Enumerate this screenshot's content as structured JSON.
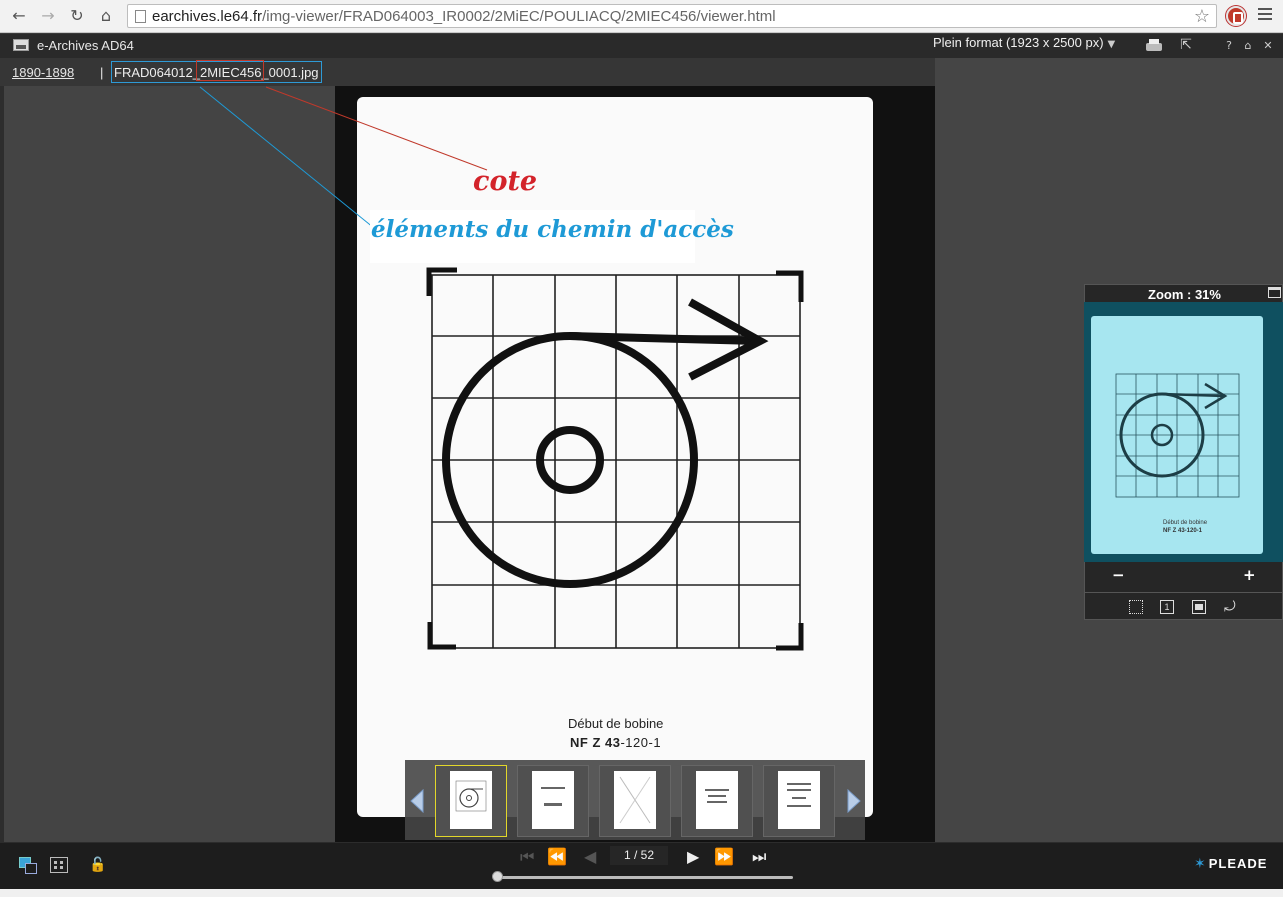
{
  "browser": {
    "url_host": "earchives.le64.fr",
    "url_path": "/img-viewer/FRAD064003_IR0002/2MiEC/POULIACQ/2MIEC456/viewer.html"
  },
  "viewer": {
    "app_title": "e-Archives AD64",
    "format_label": "Plein format (1923 x 2500 px)",
    "breadcrumb_link": "1890-1898",
    "breadcrumb_sep": "|",
    "file_name": "FRAD064012_2MIEC456_0001.jpg"
  },
  "document": {
    "caption_line1": "Début de bobine",
    "caption_line2_bold": "NF Z 43",
    "caption_line2_rest": "-120-1"
  },
  "annotations": {
    "cote": "cote",
    "path_elements": "éléments du chemin d'accès",
    "cote_color": "#d3232a",
    "path_color": "#1e9ad6"
  },
  "zoom": {
    "title": "Zoom : 31%",
    "minus": "−",
    "plus": "+",
    "one_to_one": "1"
  },
  "pager": {
    "page_input": "1 / 52"
  },
  "brand": {
    "name": "PLEADE"
  }
}
